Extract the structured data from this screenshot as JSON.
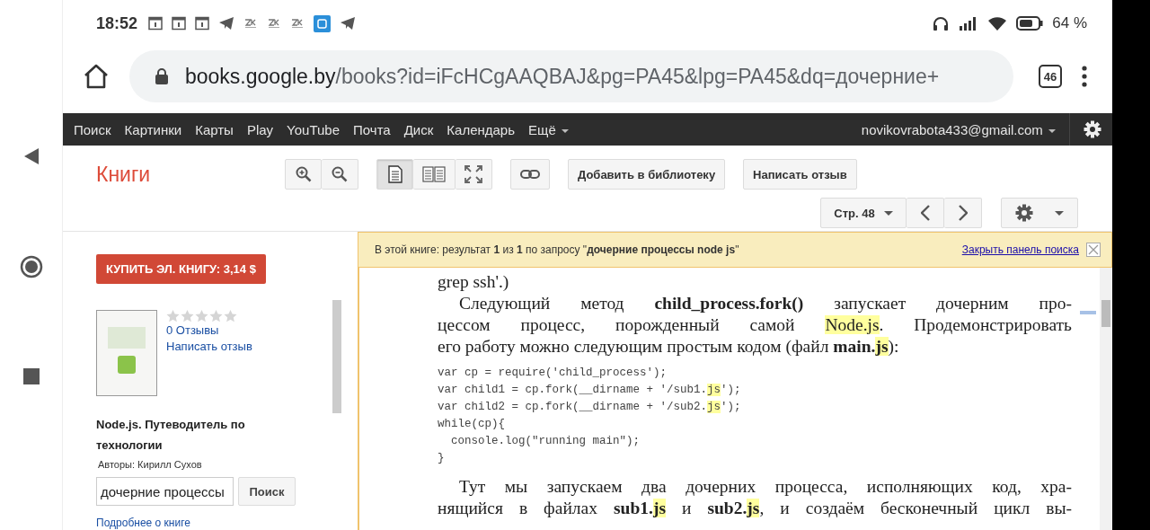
{
  "status_bar": {
    "time": "18:52",
    "battery_text": "64 %"
  },
  "address_bar": {
    "host": "books.google.by",
    "path": "/books?id=iFcHCgAAQBAJ&pg=PA45&lpg=PA45&dq=дочерние+",
    "tab_count": "46"
  },
  "google_bar": {
    "links": [
      "Поиск",
      "Картинки",
      "Карты",
      "Play",
      "YouTube",
      "Почта",
      "Диск",
      "Календарь"
    ],
    "more": "Ещё",
    "account": "novikovrabota433@gmail.com"
  },
  "books_header": {
    "logo": "Книги",
    "view_modes": [
      {
        "kind": "single",
        "selected": true
      },
      {
        "kind": "double",
        "selected": false
      },
      {
        "kind": "fullscreen",
        "selected": false
      }
    ],
    "add_button": "Добавить в библиотеку",
    "review_button": "Написать отзыв",
    "page_select": "Стр. 48"
  },
  "sidebar": {
    "buy_button": "КУПИТЬ ЭЛ. КНИГУ: 3,14 $",
    "stars": 0,
    "reviews_link": "0 Отзывы",
    "write_review_link": "Написать отзыв",
    "title": "Node.js. Путеводитель по технологии",
    "authors": "Авторы: Кирилл Сухов",
    "search": {
      "value": "дочерние процессы"
    },
    "search_button": "Поиск",
    "more_link": "Подробнее о книге"
  },
  "search_banner": {
    "message": "В этой книге: результат **1** из **1** по запросу \"**дочерние процессы node js**\"",
    "close_link": "Закрыть панель поиска"
  },
  "page": {
    "blocks": [
      {
        "kind": "paragraph",
        "indent": false,
        "continues": false,
        "lines": [
          [
            {
              "t": "grep ssh'.)"
            }
          ]
        ]
      },
      {
        "kind": "paragraph",
        "indent": true,
        "continues": false,
        "lines": [
          [
            {
              "t": "Следующий метод "
            },
            {
              "t": "child_process.fork()",
              "bold": true
            },
            {
              "t": " запускает дочерним про-"
            }
          ],
          [
            {
              "t": "цессом процесс, порожденный самой "
            },
            {
              "t": "Node.js",
              "highlighted": true
            },
            {
              "t": ". Продемонстрировать"
            }
          ],
          [
            {
              "t": "его работу можно следующим простым кодом (файл "
            },
            {
              "t": "main.",
              "bold": true
            },
            {
              "t": "js",
              "bold": true,
              "highlighted": true
            },
            {
              "t": "):"
            }
          ]
        ]
      },
      {
        "kind": "code",
        "lines": [
          [
            {
              "t": "var cp = require('child_process');"
            }
          ],
          [
            {
              "t": "var child1 = cp.fork(__dirname + '/sub1."
            },
            {
              "t": "js",
              "highlighted": true
            },
            {
              "t": "');"
            }
          ],
          [
            {
              "t": "var child2 = cp.fork(__dirname + '/sub2."
            },
            {
              "t": "js",
              "highlighted": true
            },
            {
              "t": "');"
            }
          ],
          [
            {
              "t": "while(cp){"
            }
          ],
          [
            {
              "t": "  console.log(\"running main\");"
            }
          ],
          [
            {
              "t": "}"
            }
          ]
        ]
      },
      {
        "kind": "paragraph",
        "indent": true,
        "continues": true,
        "lines": [
          [
            {
              "t": "Тут мы запускаем два дочерних процесса, исполняющих код, хра-"
            }
          ],
          [
            {
              "t": "нящийся в файлах "
            },
            {
              "t": "sub1.",
              "bold": true
            },
            {
              "t": "js",
              "bold": true,
              "highlighted": true
            },
            {
              "t": " и "
            },
            {
              "t": "sub2.",
              "bold": true
            },
            {
              "t": "js",
              "bold": true,
              "highlighted": true
            },
            {
              "t": ", и создаём бесконечный цикл вы-"
            }
          ]
        ]
      }
    ]
  }
}
